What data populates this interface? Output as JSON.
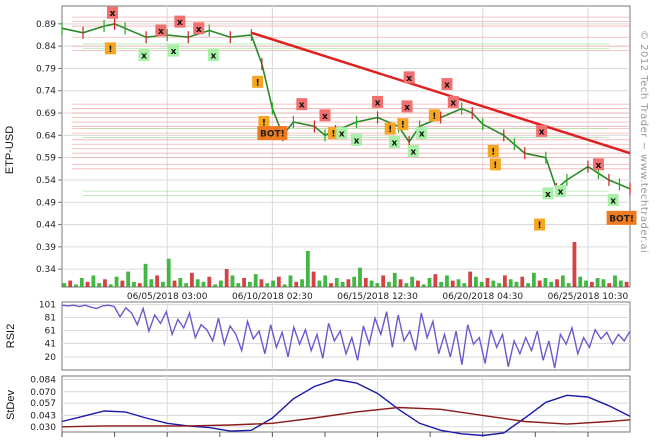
{
  "chart_data": [
    {
      "type": "line",
      "panel": "price",
      "ylabel": "ETP-USD",
      "y_ticks": [
        0.34,
        0.39,
        0.44,
        0.49,
        0.54,
        0.59,
        0.64,
        0.69,
        0.74,
        0.79,
        0.84,
        0.89
      ],
      "y_tick_labels": [
        "0.34",
        "0.39",
        "0.44",
        "0.49",
        "0.54",
        "0.59",
        "0.64",
        "0.69",
        "0.74",
        "0.79",
        "0.84",
        "0.89"
      ],
      "ylim": [
        0.3,
        0.93
      ],
      "x_tick_labels": [
        "06/05/2018 03:00",
        "06/10/2018 02:30",
        "06/15/2018 12:30",
        "06/20/2018 04:30",
        "06/25/2018 10:30"
      ],
      "x_range_days": [
        0,
        27
      ],
      "x_tick_days": [
        5.0,
        10.0,
        15.0,
        20.0,
        25.0
      ],
      "series": [
        {
          "x": [
            0,
            1,
            2,
            2.5,
            3,
            4,
            5,
            6,
            7,
            8,
            9,
            9.5,
            10,
            10.5,
            11,
            12,
            12.5,
            13,
            14,
            15,
            16,
            16.5,
            17,
            18,
            19,
            19.5,
            20,
            21,
            21.5,
            22,
            23,
            23.5,
            24,
            25,
            25.5,
            26,
            26.5,
            27
          ],
          "values": [
            0.88,
            0.87,
            0.885,
            0.89,
            0.88,
            0.86,
            0.865,
            0.86,
            0.875,
            0.86,
            0.865,
            0.8,
            0.7,
            0.64,
            0.67,
            0.66,
            0.64,
            0.65,
            0.67,
            0.68,
            0.66,
            0.625,
            0.66,
            0.68,
            0.7,
            0.69,
            0.665,
            0.64,
            0.62,
            0.6,
            0.59,
            0.52,
            0.54,
            0.57,
            0.555,
            0.54,
            0.53,
            0.52
          ]
        }
      ],
      "trendline": {
        "x": [
          9,
          27
        ],
        "y": [
          0.87,
          0.6
        ],
        "color": "#e02020"
      },
      "volume": [
        3,
        5,
        2,
        7,
        4,
        9,
        3,
        6,
        2,
        8,
        5,
        12,
        4,
        3,
        18,
        6,
        9,
        4,
        22,
        5,
        7,
        3,
        11,
        6,
        4,
        8,
        2,
        5,
        14,
        9,
        3,
        7,
        4,
        10,
        6,
        3,
        5,
        8,
        2,
        9,
        4,
        6,
        28,
        12,
        5,
        9,
        3,
        7,
        4,
        6,
        8,
        15,
        7,
        5,
        3,
        9,
        4,
        11,
        6,
        3,
        8,
        5,
        2,
        7,
        10,
        4,
        9,
        5,
        6,
        3,
        12,
        8,
        4,
        7,
        5,
        3,
        9,
        6,
        4,
        8,
        3,
        11,
        5,
        7,
        4,
        6,
        9,
        3,
        35,
        8,
        5,
        4,
        7,
        6,
        3,
        9,
        5,
        4
      ],
      "markers": [
        {
          "label": "x",
          "kind": "sell",
          "day": 2.4,
          "price": 0.915
        },
        {
          "label": "!",
          "kind": "alert",
          "day": 2.3,
          "price": 0.835
        },
        {
          "label": "x",
          "kind": "buy",
          "day": 3.9,
          "price": 0.82
        },
        {
          "label": "x",
          "kind": "sell",
          "day": 4.7,
          "price": 0.875
        },
        {
          "label": "x",
          "kind": "sell",
          "day": 5.6,
          "price": 0.895
        },
        {
          "label": "x",
          "kind": "buy",
          "day": 5.3,
          "price": 0.83
        },
        {
          "label": "x",
          "kind": "sell",
          "day": 6.5,
          "price": 0.88
        },
        {
          "label": "x",
          "kind": "buy",
          "day": 7.2,
          "price": 0.82
        },
        {
          "label": "!",
          "kind": "alert",
          "day": 9.3,
          "price": 0.76
        },
        {
          "label": "!",
          "kind": "alert",
          "day": 9.6,
          "price": 0.67
        },
        {
          "label": "x",
          "kind": "sell",
          "day": 11.4,
          "price": 0.71
        },
        {
          "label": "x",
          "kind": "sell",
          "day": 12.5,
          "price": 0.685
        },
        {
          "label": "!",
          "kind": "alert",
          "day": 12.9,
          "price": 0.645
        },
        {
          "label": "x",
          "kind": "buy",
          "day": 13.3,
          "price": 0.645
        },
        {
          "label": "x",
          "kind": "buy",
          "day": 14.0,
          "price": 0.63
        },
        {
          "label": "x",
          "kind": "sell",
          "day": 15.0,
          "price": 0.715
        },
        {
          "label": "!",
          "kind": "alert",
          "day": 15.6,
          "price": 0.655
        },
        {
          "label": "x",
          "kind": "sell",
          "day": 16.4,
          "price": 0.705
        },
        {
          "label": "!",
          "kind": "alert",
          "day": 16.2,
          "price": 0.665
        },
        {
          "label": "x",
          "kind": "buy",
          "day": 15.8,
          "price": 0.625
        },
        {
          "label": "x",
          "kind": "buy",
          "day": 16.7,
          "price": 0.605
        },
        {
          "label": "x",
          "kind": "sell",
          "day": 16.5,
          "price": 0.77
        },
        {
          "label": "x",
          "kind": "buy",
          "day": 17.1,
          "price": 0.645
        },
        {
          "label": "!",
          "kind": "alert",
          "day": 17.7,
          "price": 0.685
        },
        {
          "label": "x",
          "kind": "sell",
          "day": 18.3,
          "price": 0.755
        },
        {
          "label": "x",
          "kind": "sell",
          "day": 18.6,
          "price": 0.715
        },
        {
          "label": "!",
          "kind": "alert",
          "day": 20.5,
          "price": 0.605
        },
        {
          "label": "!",
          "kind": "alert",
          "day": 20.6,
          "price": 0.575
        },
        {
          "label": "x",
          "kind": "sell",
          "day": 22.8,
          "price": 0.65
        },
        {
          "label": "x",
          "kind": "buy",
          "day": 23.1,
          "price": 0.51
        },
        {
          "label": "!",
          "kind": "alert",
          "day": 22.7,
          "price": 0.44
        },
        {
          "label": "x",
          "kind": "buy",
          "day": 23.7,
          "price": 0.515
        },
        {
          "label": "x",
          "kind": "sell",
          "day": 25.5,
          "price": 0.575
        },
        {
          "label": "x",
          "kind": "buy",
          "day": 26.2,
          "price": 0.495
        }
      ],
      "bot_labels": [
        {
          "text": "BOT!",
          "day": 10.0,
          "price": 0.645
        },
        {
          "text": "BOT!",
          "day": 26.6,
          "price": 0.455
        }
      ]
    },
    {
      "type": "line",
      "panel": "rsi",
      "ylabel": "RSI2",
      "y_ticks": [
        20,
        41,
        61,
        81,
        101
      ],
      "y_tick_labels": [
        "20",
        "41",
        "61",
        "81",
        "101"
      ],
      "ylim": [
        0,
        105
      ],
      "color": "#6a5acd",
      "values": [
        100,
        99,
        100,
        98,
        100,
        97,
        95,
        99,
        100,
        98,
        82,
        96,
        88,
        70,
        95,
        60,
        85,
        72,
        90,
        55,
        78,
        65,
        88,
        50,
        70,
        62,
        45,
        80,
        40,
        68,
        55,
        30,
        75,
        48,
        60,
        25,
        70,
        35,
        58,
        20,
        66,
        40,
        62,
        30,
        55,
        18,
        72,
        45,
        60,
        25,
        50,
        15,
        68,
        40,
        80,
        55,
        90,
        35,
        85,
        45,
        60,
        30,
        88,
        50,
        75,
        25,
        55,
        20,
        60,
        8,
        70,
        40,
        50,
        10,
        62,
        35,
        55,
        5,
        45,
        25,
        50,
        30,
        60,
        15,
        45,
        3,
        55,
        40,
        65,
        25,
        50,
        35,
        62,
        48,
        58,
        40,
        55,
        45,
        60
      ]
    },
    {
      "type": "line",
      "panel": "stdev",
      "ylabel": "StDev",
      "y_ticks": [
        0.03,
        0.043,
        0.057,
        0.07,
        0.084
      ],
      "y_tick_labels": [
        "0.030",
        "0.043",
        "0.057",
        "0.070",
        "0.084"
      ],
      "ylim": [
        0.024,
        0.088
      ],
      "series": [
        {
          "color": "#1a1aa8",
          "x": [
            0,
            1,
            2,
            3,
            4,
            5,
            6,
            7,
            8,
            9,
            10,
            11,
            12,
            13,
            14,
            15,
            16,
            17,
            18,
            19,
            20,
            21,
            22,
            23,
            24,
            25,
            26,
            27
          ],
          "values": [
            0.036,
            0.042,
            0.048,
            0.047,
            0.04,
            0.034,
            0.031,
            0.029,
            0.025,
            0.026,
            0.04,
            0.062,
            0.076,
            0.084,
            0.08,
            0.068,
            0.05,
            0.034,
            0.026,
            0.022,
            0.02,
            0.023,
            0.04,
            0.058,
            0.066,
            0.064,
            0.054,
            0.042
          ]
        },
        {
          "color": "#8b1a1a",
          "x": [
            0,
            2,
            4,
            6,
            8,
            10,
            12,
            14,
            16,
            18,
            20,
            22,
            24,
            26,
            27
          ],
          "values": [
            0.03,
            0.031,
            0.031,
            0.031,
            0.032,
            0.034,
            0.04,
            0.047,
            0.052,
            0.05,
            0.043,
            0.036,
            0.033,
            0.036,
            0.038
          ]
        }
      ]
    }
  ],
  "watermark": "© 2012 Tech Trader ~ www.techtrader.ai",
  "colors": {
    "trend_red": "#e02020",
    "sell_marker": "#f07070",
    "buy_marker": "#a8f0a8",
    "alert_marker": "#f5a623",
    "bot_label": "#f07a20",
    "resistance_lines": "#f2a0a0",
    "support_lines": "#9ee69e",
    "price_up": "#22aa22",
    "price_down": "#cc2222"
  }
}
